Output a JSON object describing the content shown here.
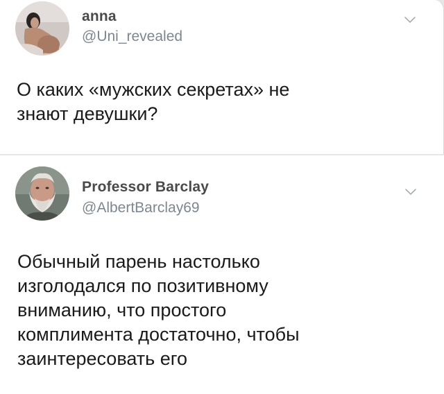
{
  "tweets": [
    {
      "display_name": "anna",
      "handle": "@Uni_revealed",
      "text_lines": [
        "О каких «мужских секретах» не",
        "знают девушки?"
      ],
      "avatar_icon": "profile-photo-icon"
    },
    {
      "display_name": "Professor Barclay",
      "handle": "@AlbertBarclay69",
      "text_lines": [
        "Обычный парень настолько",
        "изголодался по позитивному",
        "вниманию, что простого",
        "комплимента достаточно, чтобы",
        "заинтересовать его"
      ],
      "avatar_icon": "profile-photo-icon"
    }
  ],
  "icons": {
    "menu": "chevron-down-icon"
  },
  "colors": {
    "name": "#4a4a4a",
    "handle": "#7d8790",
    "text": "#1a1a1a",
    "background": "#ffffff",
    "separator": "#e6e6e6"
  }
}
